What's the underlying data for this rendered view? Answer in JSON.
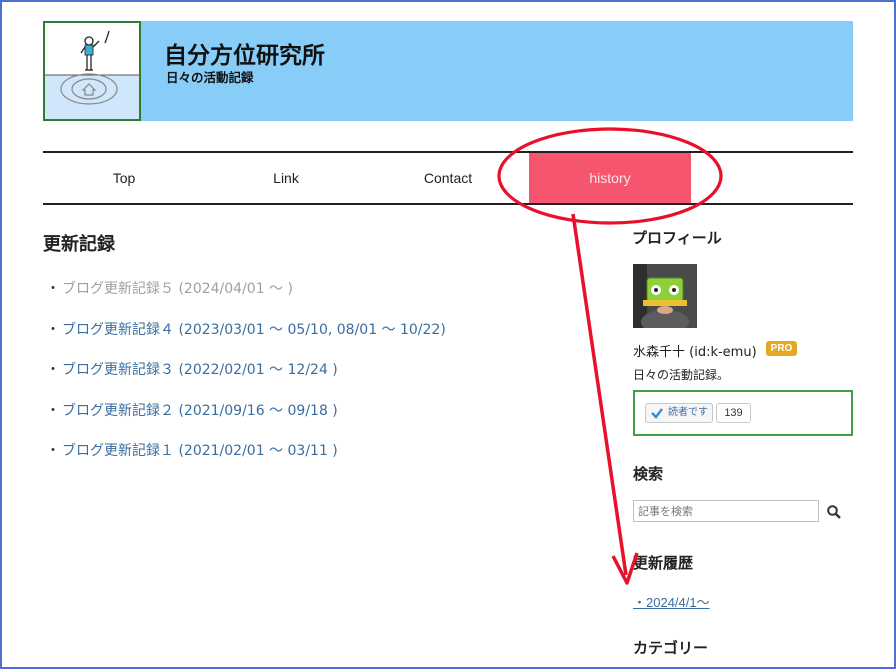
{
  "site": {
    "title": "自分方位研究所",
    "subtitle": "日々の活動記録"
  },
  "nav": {
    "items": [
      {
        "label": "Top"
      },
      {
        "label": "Link"
      },
      {
        "label": "Contact"
      },
      {
        "label": "history"
      }
    ],
    "active": "history"
  },
  "main": {
    "title": "更新記録",
    "bullet": "・",
    "records": [
      {
        "label": "ブログ更新記録５ (2024/04/01 ～ )"
      },
      {
        "label": "ブログ更新記録４ (2023/03/01 ～ 05/10, 08/01 ～ 10/22)"
      },
      {
        "label": "ブログ更新記録３ (2022/02/01 ～ 12/24 )"
      },
      {
        "label": "ブログ更新記録２ (2021/09/16 ～ 09/18 )"
      },
      {
        "label": "ブログ更新記録１ (2021/02/01 ～ 03/11 )"
      }
    ]
  },
  "sidebar": {
    "profile": {
      "heading": "プロフィール",
      "name": "水森千十 (id:k-emu)",
      "badge": "PRO",
      "description": "日々の活動記録。",
      "reader_label": "読者です",
      "reader_count": "139"
    },
    "search": {
      "heading": "検索",
      "placeholder": "記事を検索"
    },
    "history": {
      "heading": "更新履歴",
      "link": "・2024/4/1〜"
    },
    "category": {
      "heading": "カテゴリー"
    }
  },
  "colors": {
    "header_bg": "#87cdf8",
    "nav_active_bg": "#f5556e",
    "annotation_red": "#e8102a",
    "link": "#3a6ea0",
    "reader_box_border": "#3fa046",
    "pro_badge": "#e5a822"
  },
  "icons": {
    "logo": "person-on-circle-logo",
    "search": "search-icon",
    "check": "check-icon"
  }
}
